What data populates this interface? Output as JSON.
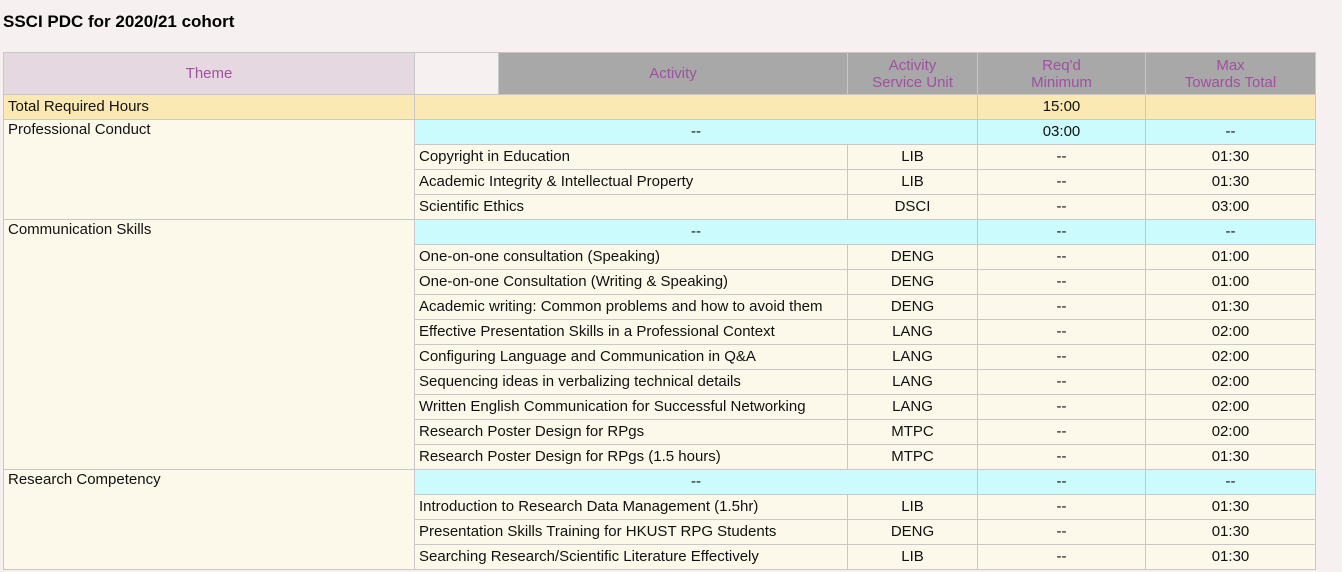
{
  "page_title": "SSCI PDC for 2020/21 cohort",
  "headers": {
    "theme": "Theme",
    "activity": "Activity",
    "service_unit_l1": "Activity",
    "service_unit_l2": "Service Unit",
    "minimum_l1": "Req'd",
    "minimum_l2": "Minimum",
    "max_l1": "Max",
    "max_l2": "Towards Total"
  },
  "total_row": {
    "label": "Total Required Hours",
    "minimum": "15:00"
  },
  "themes": [
    {
      "name": "Professional Conduct",
      "summary": {
        "activity": "--",
        "minimum": "03:00",
        "max": "--"
      },
      "activities": [
        {
          "name": "Copyright in Education",
          "unit": "LIB",
          "minimum": "--",
          "max": "01:30"
        },
        {
          "name": "Academic Integrity & Intellectual Property",
          "unit": "LIB",
          "minimum": "--",
          "max": "01:30"
        },
        {
          "name": "Scientific Ethics",
          "unit": "DSCI",
          "minimum": "--",
          "max": "03:00"
        }
      ]
    },
    {
      "name": "Communication Skills",
      "summary": {
        "activity": "--",
        "minimum": "--",
        "max": "--"
      },
      "activities": [
        {
          "name": "One-on-one consultation (Speaking)",
          "unit": "DENG",
          "minimum": "--",
          "max": "01:00"
        },
        {
          "name": "One-on-one Consultation (Writing & Speaking)",
          "unit": "DENG",
          "minimum": "--",
          "max": "01:00"
        },
        {
          "name": "Academic writing: Common problems and how to avoid them",
          "unit": "DENG",
          "minimum": "--",
          "max": "01:30"
        },
        {
          "name": "Effective Presentation Skills in a Professional Context",
          "unit": "LANG",
          "minimum": "--",
          "max": "02:00"
        },
        {
          "name": "Configuring Language and Communication in Q&A",
          "unit": "LANG",
          "minimum": "--",
          "max": "02:00"
        },
        {
          "name": "Sequencing ideas in verbalizing technical details",
          "unit": "LANG",
          "minimum": "--",
          "max": "02:00"
        },
        {
          "name": "Written English Communication for Successful Networking",
          "unit": "LANG",
          "minimum": "--",
          "max": "02:00"
        },
        {
          "name": "Research Poster Design for RPgs",
          "unit": "MTPC",
          "minimum": "--",
          "max": "02:00"
        },
        {
          "name": "Research Poster Design for RPgs (1.5 hours)",
          "unit": "MTPC",
          "minimum": "--",
          "max": "01:30"
        }
      ]
    },
    {
      "name": "Research Competency",
      "summary": {
        "activity": "--",
        "minimum": "--",
        "max": "--"
      },
      "activities": [
        {
          "name": "Introduction to Research Data Management (1.5hr)",
          "unit": "LIB",
          "minimum": "--",
          "max": "01:30"
        },
        {
          "name": "Presentation Skills Training for HKUST RPG Students",
          "unit": "DENG",
          "minimum": "--",
          "max": "01:30"
        },
        {
          "name": "Searching Research/Scientific Literature Effectively",
          "unit": "LIB",
          "minimum": "--",
          "max": "01:30"
        }
      ]
    }
  ]
}
